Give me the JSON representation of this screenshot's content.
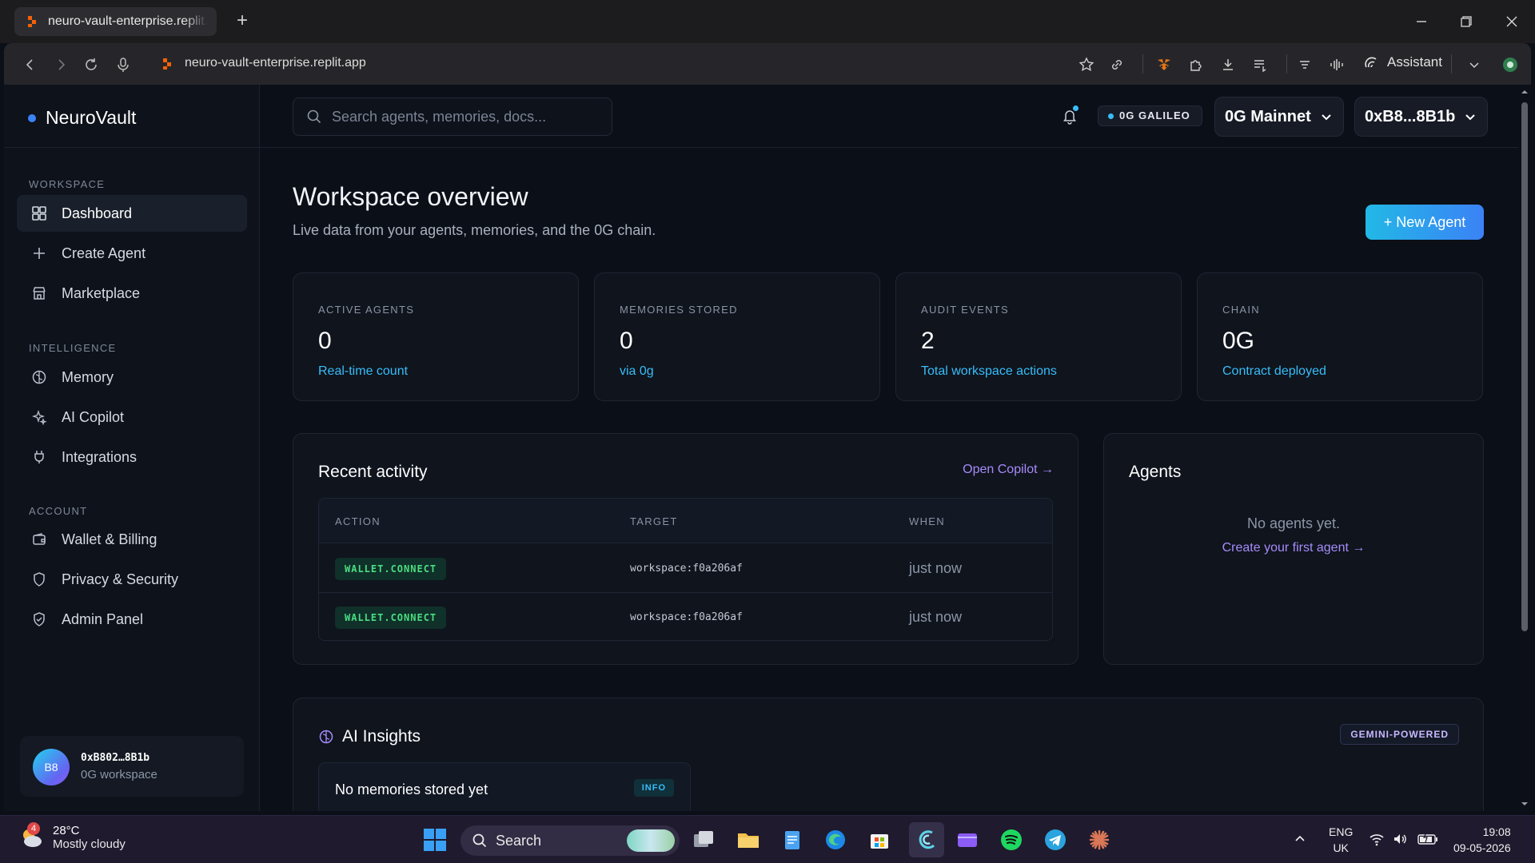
{
  "browser": {
    "tab_title": "neuro-vault-enterprise.replit.app",
    "url": "neuro-vault-enterprise.replit.app",
    "assistant_label": "Assistant"
  },
  "app": {
    "brand": "NeuroVault",
    "search_placeholder": "Search agents, memories, docs...",
    "network_badge": "0G GALILEO",
    "network_select": "0G Mainnet",
    "wallet_select": "0xB8...8B1b",
    "sidebar": {
      "workspace_label": "WORKSPACE",
      "intelligence_label": "INTELLIGENCE",
      "account_label": "ACCOUNT",
      "items": [
        {
          "label": "Dashboard"
        },
        {
          "label": "Create Agent"
        },
        {
          "label": "Marketplace"
        },
        {
          "label": "Memory"
        },
        {
          "label": "AI Copilot"
        },
        {
          "label": "Integrations"
        },
        {
          "label": "Wallet & Billing"
        },
        {
          "label": "Privacy & Security"
        },
        {
          "label": "Admin Panel"
        }
      ],
      "user": {
        "initials": "B8",
        "address": "0xB802…8B1b",
        "workspace": "0G workspace"
      }
    },
    "page": {
      "title": "Workspace overview",
      "subtitle": "Live data from your agents, memories, and the 0G chain.",
      "new_agent_button": "+ New Agent"
    },
    "stats": [
      {
        "label": "ACTIVE AGENTS",
        "value": "0",
        "sub": "Real-time count"
      },
      {
        "label": "MEMORIES STORED",
        "value": "0",
        "sub": "via 0g"
      },
      {
        "label": "AUDIT EVENTS",
        "value": "2",
        "sub": "Total workspace actions"
      },
      {
        "label": "CHAIN",
        "value": "0G",
        "sub": "Contract deployed"
      }
    ],
    "activity": {
      "title": "Recent activity",
      "link": "Open Copilot →",
      "columns": [
        "ACTION",
        "TARGET",
        "WHEN"
      ],
      "rows": [
        {
          "action": "WALLET.CONNECT",
          "target": "workspace:f0a206af",
          "when": "just now"
        },
        {
          "action": "WALLET.CONNECT",
          "target": "workspace:f0a206af",
          "when": "just now"
        }
      ]
    },
    "agents": {
      "title": "Agents",
      "empty": "No agents yet.",
      "create_link": "Create your first agent →"
    },
    "insights": {
      "title": "AI Insights",
      "badge": "GEMINI-POWERED",
      "item_title": "No memories stored yet",
      "item_badge": "INFO"
    }
  },
  "taskbar": {
    "weather_temp": "28°C",
    "weather_desc": "Mostly cloudy",
    "weather_alert_count": "4",
    "search_label": "Search",
    "lang": "ENG",
    "region": "UK",
    "time": "19:08",
    "date": "09-05-2026"
  },
  "colors": {
    "accent": "#38bdf8",
    "link_purple": "#a78bfa",
    "badge_green": "#4ade80",
    "background": "#0b0f17"
  }
}
